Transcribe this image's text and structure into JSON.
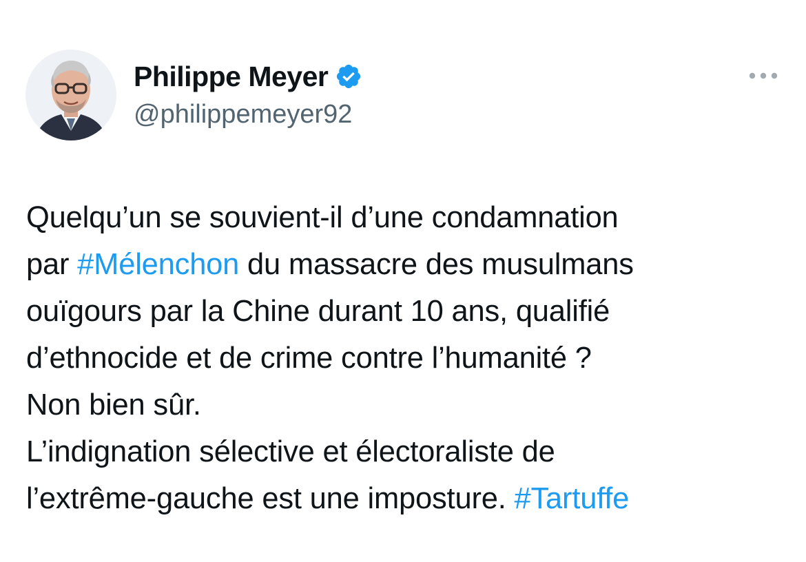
{
  "author": {
    "display_name": "Philippe Meyer",
    "handle": "@philippemeyer92",
    "verified": true,
    "verified_badge_icon": "verified-badge-icon",
    "avatar_icon": "profile-photo"
  },
  "menu": {
    "icon": "more-options-icon"
  },
  "tweet": {
    "lines": [
      {
        "segments": [
          {
            "text": "Quelqu’un se souvient-il d’une condamnation",
            "hashtag": false
          }
        ]
      },
      {
        "segments": [
          {
            "text": "par ",
            "hashtag": false
          },
          {
            "text": "#Mélenchon",
            "hashtag": true
          },
          {
            "text": " du massacre des musulmans",
            "hashtag": false
          }
        ]
      },
      {
        "segments": [
          {
            "text": "ouïgours par la Chine durant 10 ans, qualifié",
            "hashtag": false
          }
        ]
      },
      {
        "segments": [
          {
            "text": "d’ethnocide et de crime contre l’humanité ?",
            "hashtag": false
          }
        ]
      },
      {
        "segments": [
          {
            "text": "Non bien sûr.",
            "hashtag": false
          }
        ]
      },
      {
        "segments": [
          {
            "text": "L’indignation sélective et électoraliste de",
            "hashtag": false
          }
        ]
      },
      {
        "segments": [
          {
            "text": "l’extrême-gauche est une imposture. ",
            "hashtag": false
          },
          {
            "text": "#Tartuffe",
            "hashtag": true
          }
        ]
      }
    ]
  },
  "colors": {
    "text": "#0f1419",
    "secondary": "#536471",
    "link": "#1d9bf0",
    "verified": "#1d9bf0"
  }
}
